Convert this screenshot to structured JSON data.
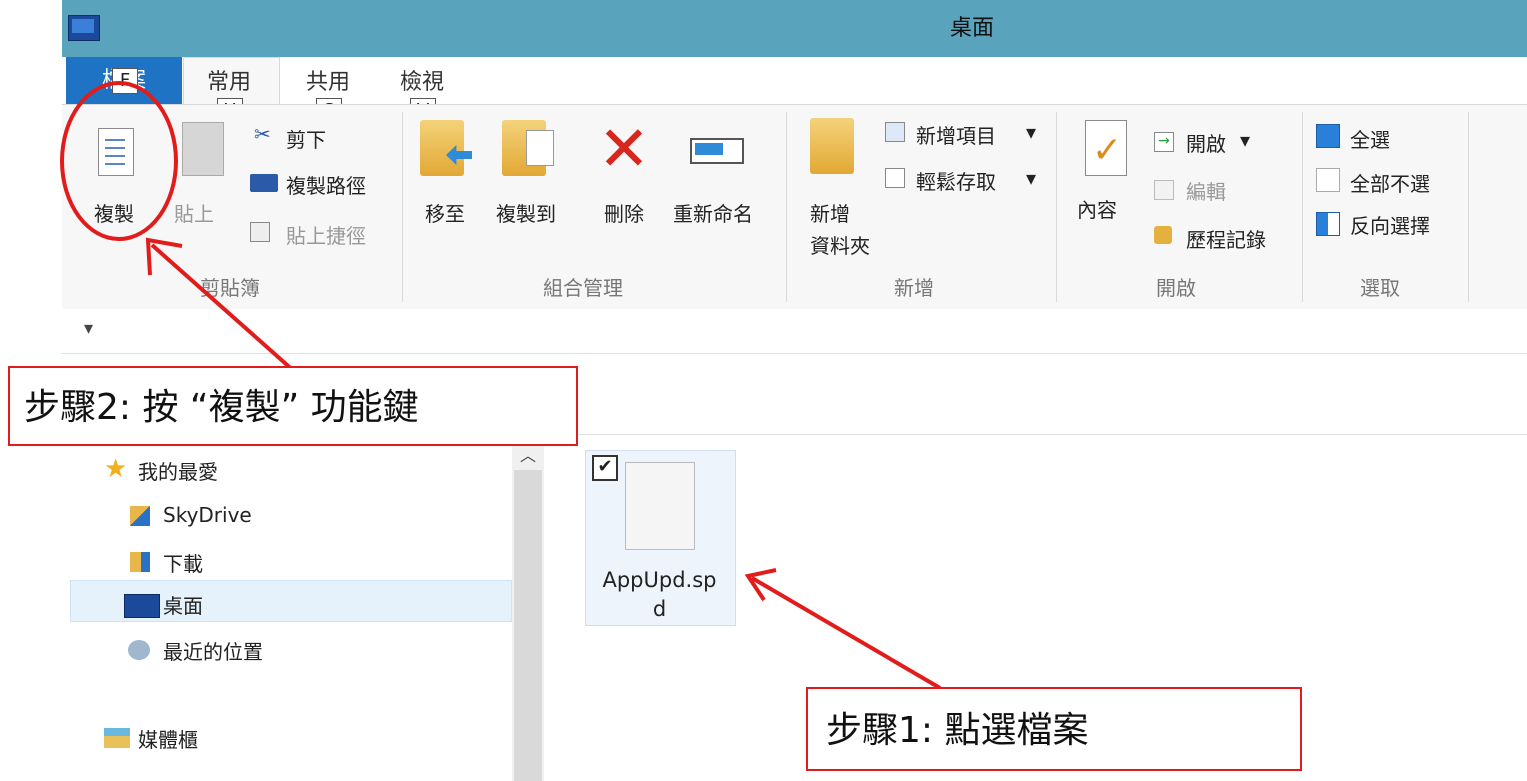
{
  "window": {
    "title": "桌面"
  },
  "tabs": {
    "file": "檔案",
    "home": "常用",
    "share": "共用",
    "view": "檢視",
    "keytip_file": "F",
    "keytip_home": "H",
    "keytip_share": "S",
    "keytip_view": "V"
  },
  "ribbon": {
    "clipboard": {
      "group_label": "剪貼簿",
      "copy": "複製",
      "paste": "貼上",
      "cut": "剪下",
      "copy_path": "複製路徑",
      "paste_shortcut": "貼上捷徑"
    },
    "organize": {
      "group_label": "組合管理",
      "move_to": "移至",
      "copy_to": "複製到",
      "delete": "刪除",
      "rename": "重新命名"
    },
    "new": {
      "group_label": "新增",
      "new_folder_1": "新增",
      "new_folder_2": "資料夾",
      "new_item": "新增項目",
      "easy_access": "輕鬆存取"
    },
    "open": {
      "group_label": "開啟",
      "properties": "內容",
      "open": "開啟",
      "edit": "編輯",
      "history": "歷程記錄"
    },
    "select": {
      "group_label": "選取",
      "select_all": "全選",
      "select_none": "全部不選",
      "invert": "反向選擇"
    }
  },
  "quick_access": {
    "dropdown": "▾"
  },
  "nav": {
    "favorites": "我的最愛",
    "skydrive": "SkyDrive",
    "downloads": "下載",
    "desktop": "桌面",
    "recent": "最近的位置",
    "libraries": "媒體櫃"
  },
  "content": {
    "file_name_line1": "AppUpd.sp",
    "file_name_line2": "d",
    "checked_mark": "✔"
  },
  "annotations": {
    "step2": "步驟2:  按 “複製” 功能鍵",
    "step1": "步驟1: 點選檔案"
  },
  "colors": {
    "titlebar": "#5aa3bd",
    "file_tab": "#1e73c4",
    "annotation_red": "#e21b1b"
  }
}
